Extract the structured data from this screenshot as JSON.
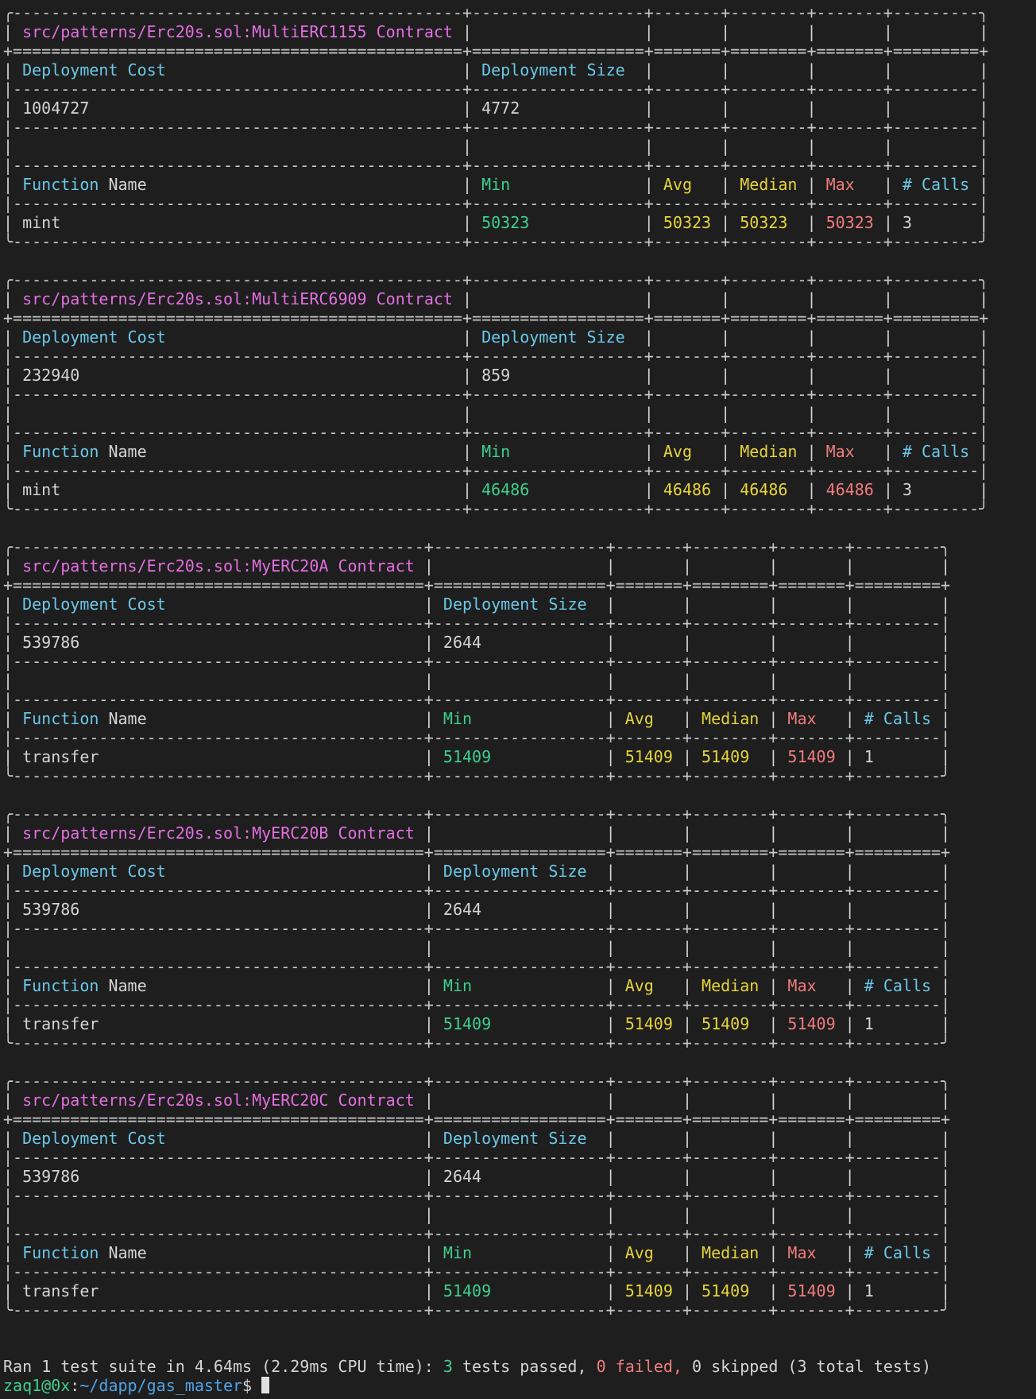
{
  "colors": {
    "background": "#1e1e1e",
    "text": "#d4d4d4",
    "contract_name": "#e36fe0",
    "header": "#6ac8e8",
    "min": "#3ecf8e",
    "avg_median": "#e6d43a",
    "max": "#f07c7c"
  },
  "labels": {
    "deployment_cost": "Deployment Cost",
    "deployment_size": "Deployment Size",
    "function": "Function",
    "name": "Name",
    "min": "Min",
    "avg": "Avg",
    "median": "Median",
    "max": "Max",
    "calls": "# Calls"
  },
  "tables": [
    {
      "title": "src/patterns/Erc20s.sol:MultiERC1155 Contract",
      "deployment_cost": "1004727",
      "deployment_size": "4772",
      "functions": [
        {
          "name": "mint",
          "min": "50323",
          "avg": "50323",
          "median": "50323",
          "max": "50323",
          "calls": "3"
        }
      ]
    },
    {
      "title": "src/patterns/Erc20s.sol:MultiERC6909 Contract",
      "deployment_cost": "232940",
      "deployment_size": "859",
      "functions": [
        {
          "name": "mint",
          "min": "46486",
          "avg": "46486",
          "median": "46486",
          "max": "46486",
          "calls": "3"
        }
      ]
    },
    {
      "title": "src/patterns/Erc20s.sol:MyERC20A Contract",
      "deployment_cost": "539786",
      "deployment_size": "2644",
      "functions": [
        {
          "name": "transfer",
          "min": "51409",
          "avg": "51409",
          "median": "51409",
          "max": "51409",
          "calls": "1"
        }
      ]
    },
    {
      "title": "src/patterns/Erc20s.sol:MyERC20B Contract",
      "deployment_cost": "539786",
      "deployment_size": "2644",
      "functions": [
        {
          "name": "transfer",
          "min": "51409",
          "avg": "51409",
          "median": "51409",
          "max": "51409",
          "calls": "1"
        }
      ]
    },
    {
      "title": "src/patterns/Erc20s.sol:MyERC20C Contract",
      "deployment_cost": "539786",
      "deployment_size": "2644",
      "functions": [
        {
          "name": "transfer",
          "min": "51409",
          "avg": "51409",
          "median": "51409",
          "max": "51409",
          "calls": "1"
        }
      ]
    }
  ],
  "summary": {
    "prefix": "Ran 1 test suite in 4.64ms (2.29ms CPU time): ",
    "passed_count": "3",
    "passed_text": " tests passed, ",
    "failed_count": "0",
    "failed_text": " failed, ",
    "skipped_count": "0",
    "skipped_text": " skipped (3 total tests)"
  },
  "prompt": {
    "user_host": "zaq1@0x",
    "separator": ":",
    "path": "~/dapp/gas_master",
    "symbol": "$ "
  }
}
